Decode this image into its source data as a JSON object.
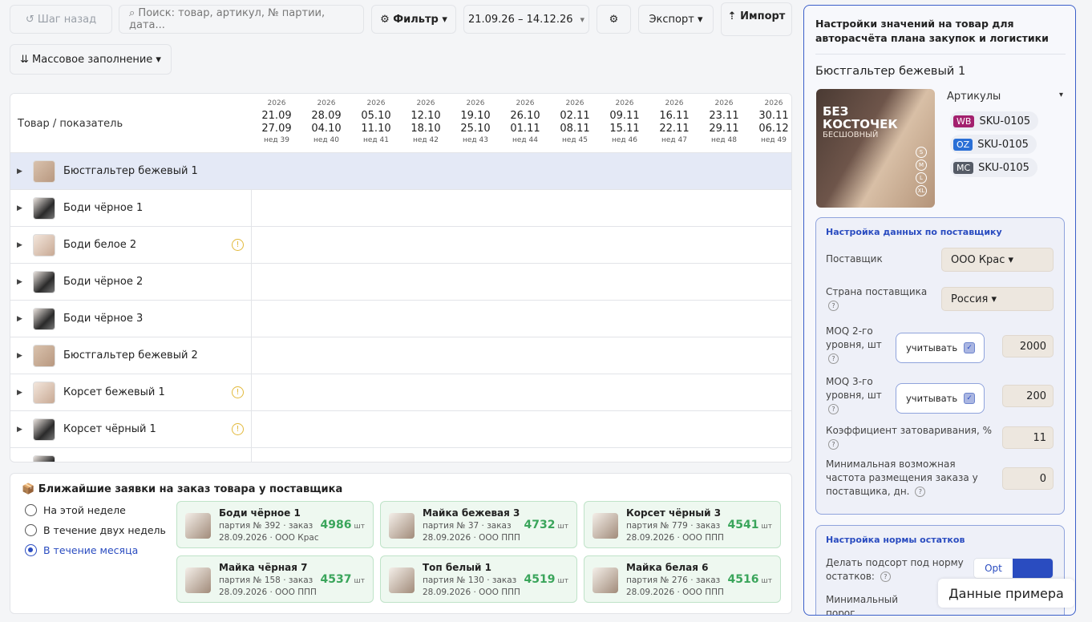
{
  "toolbar": {
    "back": "↺ Шаг назад",
    "search_placeholder": "⌕  Поиск: товар, артикул, № партии, дата...",
    "filter": "⚙ Фильтр ▾",
    "date_range": "21.09.26 – 14.12.26",
    "date_range_chevron": "▾",
    "settings": "⚙",
    "export": "Экспорт ▾",
    "import": "⇡ Импорт",
    "bulk_fill": "⇊ Массовое заполнение ▾"
  },
  "grid": {
    "column_header": "Товар / показатель",
    "weeks": [
      {
        "year": "2026",
        "start": "21.09",
        "end": "27.09",
        "week": "нед 39"
      },
      {
        "year": "2026",
        "start": "28.09",
        "end": "04.10",
        "week": "нед 40"
      },
      {
        "year": "2026",
        "start": "05.10",
        "end": "11.10",
        "week": "нед 41"
      },
      {
        "year": "2026",
        "start": "12.10",
        "end": "18.10",
        "week": "нед 42"
      },
      {
        "year": "2026",
        "start": "19.10",
        "end": "25.10",
        "week": "нед 43"
      },
      {
        "year": "2026",
        "start": "26.10",
        "end": "01.11",
        "week": "нед 44"
      },
      {
        "year": "2026",
        "start": "02.11",
        "end": "08.11",
        "week": "нед 45"
      },
      {
        "year": "2026",
        "start": "09.11",
        "end": "15.11",
        "week": "нед 46"
      },
      {
        "year": "2026",
        "start": "16.11",
        "end": "22.11",
        "week": "нед 47"
      },
      {
        "year": "2026",
        "start": "23.11",
        "end": "29.11",
        "week": "нед 48"
      },
      {
        "year": "2026",
        "start": "30.11",
        "end": "06.12",
        "week": "нед 49"
      }
    ],
    "rows": [
      {
        "name": "Бюстгальтер бежевый 1",
        "warning": false,
        "selected": true
      },
      {
        "name": "Боди чёрное 1",
        "warning": false
      },
      {
        "name": "Боди белое 2",
        "warning": true
      },
      {
        "name": "Боди чёрное 2",
        "warning": false
      },
      {
        "name": "Боди чёрное 3",
        "warning": false
      },
      {
        "name": "Бюстгальтер бежевый 2",
        "warning": false
      },
      {
        "name": "Корсет бежевый 1",
        "warning": true
      },
      {
        "name": "Корсет чёрный 1",
        "warning": true
      }
    ],
    "expand_glyph": "▶",
    "warning_glyph": "!"
  },
  "orders": {
    "title": "📦 Ближайшие заявки на заказ товара у поставщика",
    "periods": [
      "На этой неделе",
      "В течение двух недель",
      "В течение месяца"
    ],
    "selected_period": "В течение месяца",
    "unit": "шт",
    "cards": [
      {
        "name": "Боди чёрное 1",
        "batch": "партия № 392 · заказ",
        "date_supplier": "28.09.2026 · ООО Крас",
        "qty": "4986"
      },
      {
        "name": "Майка бежевая 3",
        "batch": "партия № 37 · заказ",
        "date_supplier": "28.09.2026 · ООО ППП",
        "qty": "4732"
      },
      {
        "name": "Корсет чёрный 3",
        "batch": "партия № 779 · заказ",
        "date_supplier": "28.09.2026 · ООО ППП",
        "qty": "4541"
      },
      {
        "name": "Майка чёрная 7",
        "batch": "партия № 158 · заказ",
        "date_supplier": "28.09.2026 · ООО ППП",
        "qty": "4537"
      },
      {
        "name": "Топ белый 1",
        "batch": "партия № 130 · заказ",
        "date_supplier": "28.09.2026 · ООО ППП",
        "qty": "4519"
      },
      {
        "name": "Майка белая 6",
        "batch": "партия № 276 · заказ",
        "date_supplier": "28.09.2026 · ООО ППП",
        "qty": "4516"
      }
    ]
  },
  "settings_panel": {
    "title": "Настройки значений на товар для авторасчёта плана закупок и логистики",
    "product_name": "Бюстгальтер бежевый 1",
    "image_text": {
      "line1": "БЕЗ",
      "line2": "КОСТОЧЕК",
      "line3": "БЕСШОВНЫЙ",
      "sizes": [
        "S",
        "M",
        "L",
        "XL"
      ]
    },
    "articles_label": "Артикулы",
    "articles_chevron": "▾",
    "skus": [
      {
        "badge": "WB",
        "badge_color": "#a3206e",
        "code": "SKU-0105"
      },
      {
        "badge": "OZ",
        "badge_color": "#2a6fd6",
        "code": "SKU-0105"
      },
      {
        "badge": "MC",
        "badge_color": "#555b66",
        "code": "SKU-0105"
      }
    ],
    "supplier_section": {
      "title": "Настройка данных по поставщику",
      "supplier_label": "Поставщик",
      "supplier_value": "ООО Крас ▾",
      "country_label": "Страна поставщика",
      "country_value": "Россия ▾",
      "moq2_label": "MOQ 2-го уровня, шт",
      "moq2_check": "учитывать",
      "moq2_value": "2000",
      "moq3_label": "MOQ 3-го уровня, шт",
      "moq3_check": "учитывать",
      "moq3_value": "200",
      "overstock_label": "Коэффициент затоваривания, %",
      "overstock_value": "11",
      "min_freq_label": "Минимальная возможная частота размещения заказа у поставщика, дн.",
      "min_freq_value": "0"
    },
    "stock_section": {
      "title": "Настройка нормы остатков",
      "restock_label": "Делать подсорт под норму остатков:",
      "restock_toggle": "Opt",
      "min_threshold_label": "Минимальный порог"
    },
    "help_glyph": "?",
    "check_glyph": "✓"
  },
  "demo_badge": "Данные примера",
  "colors": {
    "accent": "#2a4cc0",
    "success": "#3aa55b",
    "warning": "#e2b93b"
  }
}
